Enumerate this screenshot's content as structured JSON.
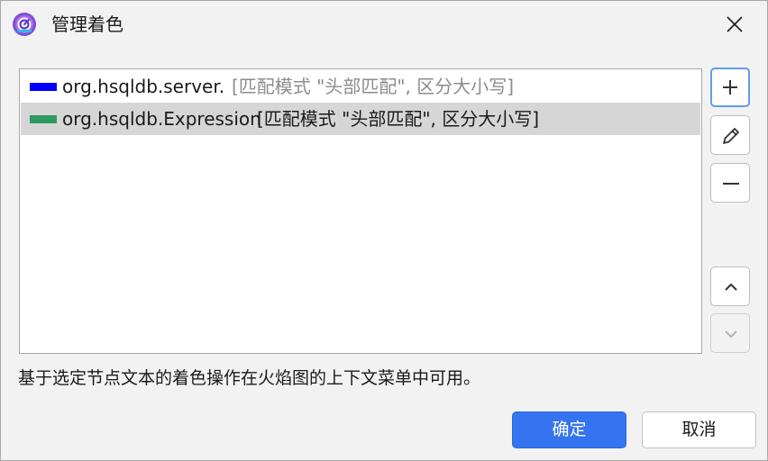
{
  "window": {
    "title": "管理着色",
    "icon": "profiler-app-icon",
    "close_icon": "close-icon"
  },
  "colorings": [
    {
      "name": "org.hsqldb.server.",
      "description": "[匹配模式 \"头部匹配\", 区分大小写]",
      "color": "#0000ff",
      "selected": false,
      "description_muted": true
    },
    {
      "name": "org.hsqldb.Expression",
      "description": "[匹配模式 \"头部匹配\", 区分大小写]",
      "color": "#2e9960",
      "selected": true,
      "description_muted": false
    }
  ],
  "side_buttons": [
    {
      "name": "add",
      "icon": "plus-icon",
      "enabled": true
    },
    {
      "name": "edit",
      "icon": "pencil-icon",
      "enabled": true
    },
    {
      "name": "remove",
      "icon": "minus-icon",
      "enabled": true
    },
    {
      "name": "move-up",
      "icon": "chevron-up-icon",
      "enabled": true
    },
    {
      "name": "move-down",
      "icon": "chevron-down-icon",
      "enabled": false
    }
  ],
  "hint": "基于选定节点文本的着色操作在火焰图的上下文菜单中可用。",
  "footer": {
    "ok_label": "确定",
    "cancel_label": "取消"
  },
  "colors": {
    "accent": "#3574f0",
    "selection": "#d6d6d6",
    "muted_text": "#8c8c8c"
  }
}
